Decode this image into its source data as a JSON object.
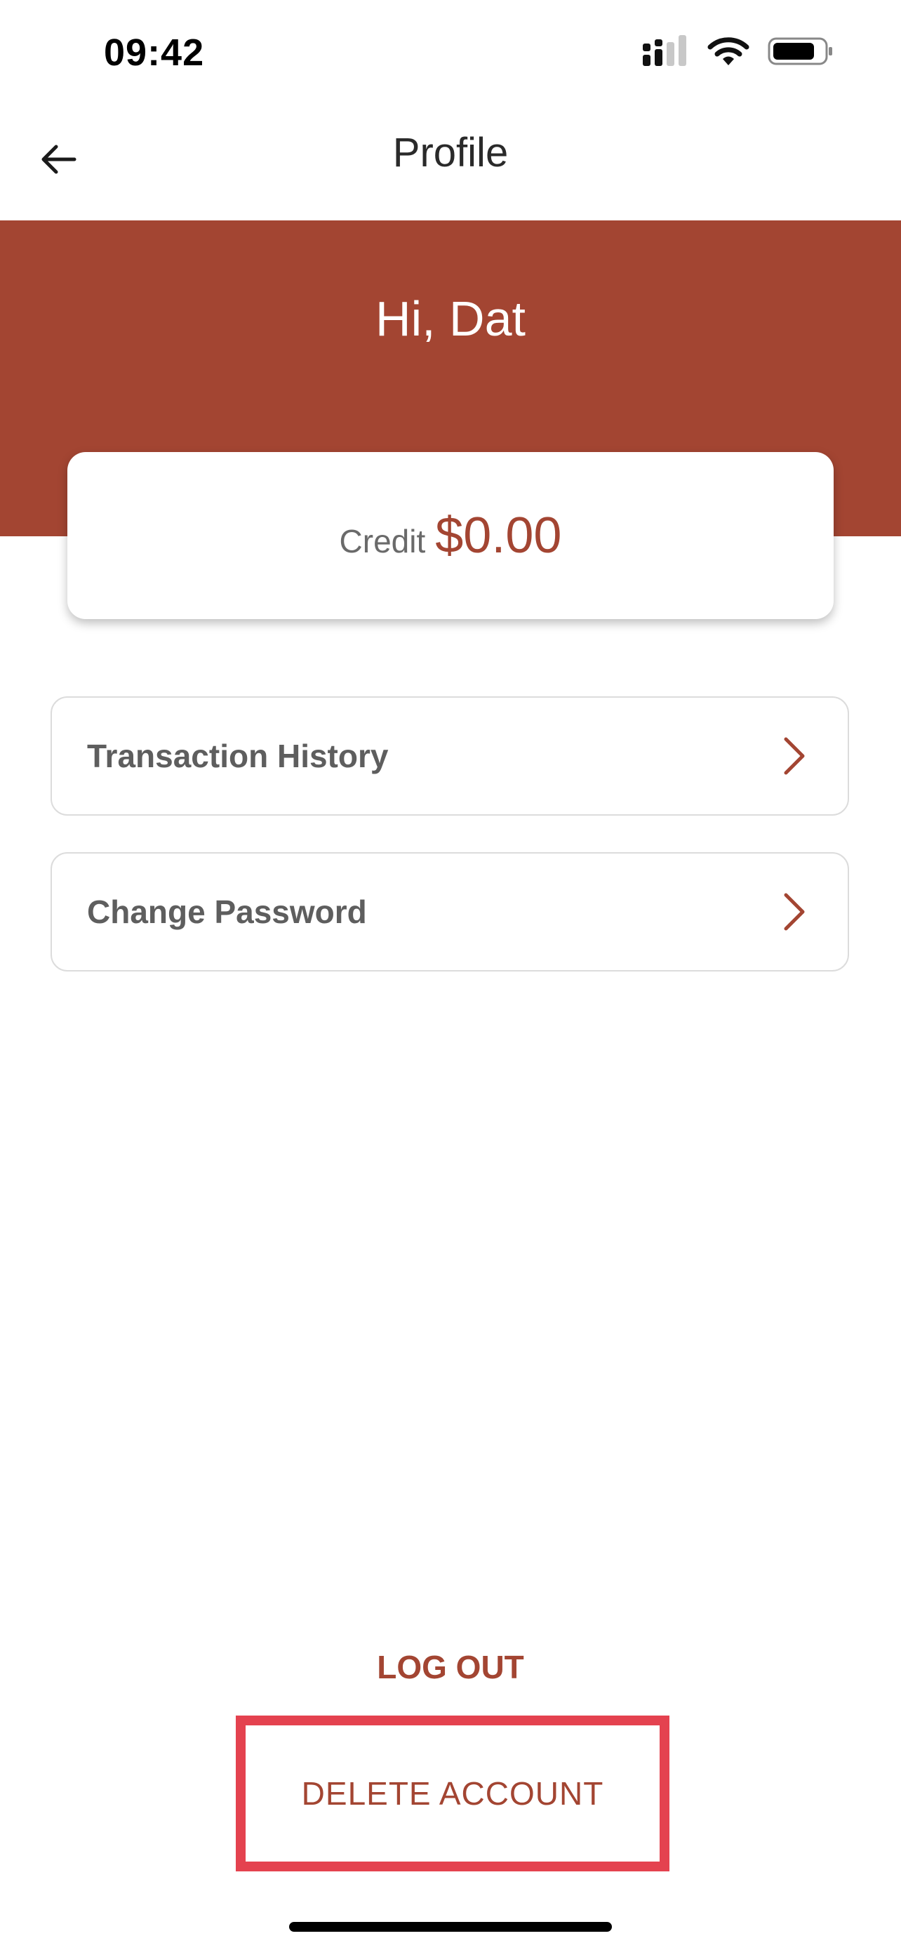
{
  "status_bar": {
    "time": "09:42",
    "icons": [
      "signal-icon",
      "wifi-icon",
      "battery-icon"
    ]
  },
  "nav": {
    "title": "Profile",
    "back_icon": "arrow-left-icon"
  },
  "header": {
    "greeting": "Hi, Dat",
    "background_color": "#a34532"
  },
  "credit": {
    "label": "Credit",
    "amount": "$0.00"
  },
  "menu": {
    "items": [
      {
        "label": "Transaction History",
        "icon": "chevron-right-icon"
      },
      {
        "label": "Change Password",
        "icon": "chevron-right-icon"
      }
    ]
  },
  "actions": {
    "logout_label": "LOG OUT",
    "delete_label": "DELETE ACCOUNT",
    "highlight_color": "#e4424f"
  },
  "colors": {
    "accent": "#a34532"
  }
}
